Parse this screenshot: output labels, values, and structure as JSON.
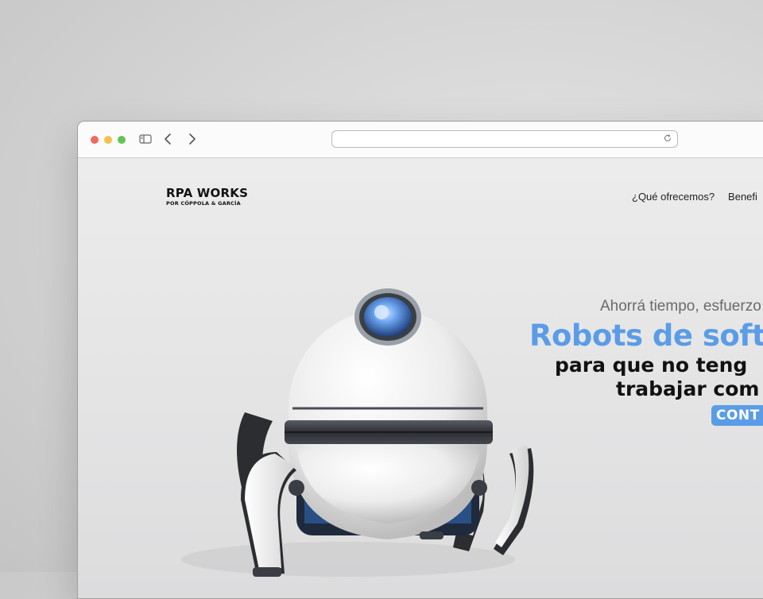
{
  "browser": {
    "address_value": "",
    "icons": [
      "sidebar-icon",
      "back-arrow-icon",
      "forward-arrow-icon",
      "reload-icon"
    ]
  },
  "site": {
    "logo_title": "RPA WORKS",
    "logo_subtitle": "POR CÓPPOLA & GARCÍA",
    "nav": [
      "¿Qué ofrecemos?",
      "Benefi"
    ]
  },
  "hero": {
    "tagline": "Ahorrá tiempo, esfuerzo",
    "headline": "Robots de soft",
    "subline1": "para que no teng",
    "subline2": "trabajar com",
    "cta_label": "CONT",
    "accent_color": "#5b9ce6",
    "image": "robot-illustration"
  }
}
